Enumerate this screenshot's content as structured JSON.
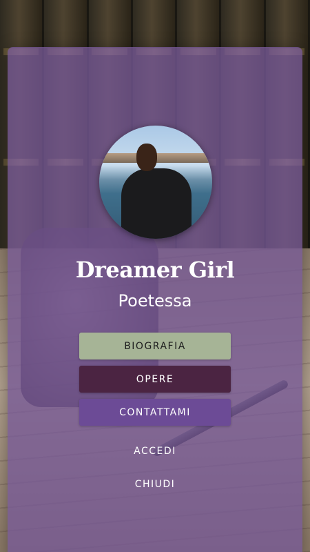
{
  "profile": {
    "name": "Dreamer Girl",
    "role": "Poetessa",
    "avatar_icon": "profile-photo"
  },
  "menu": {
    "biografia": "BIOGRAFIA",
    "opere": "OPERE",
    "contattami": "CONTATTAMI",
    "accedi": "ACCEDI",
    "chiudi": "CHIUDI"
  },
  "colors": {
    "card": "#7658964",
    "biografia_bg": "#a6b496",
    "opere_bg": "#4b2442",
    "contattami_bg": "#6c4b96"
  }
}
